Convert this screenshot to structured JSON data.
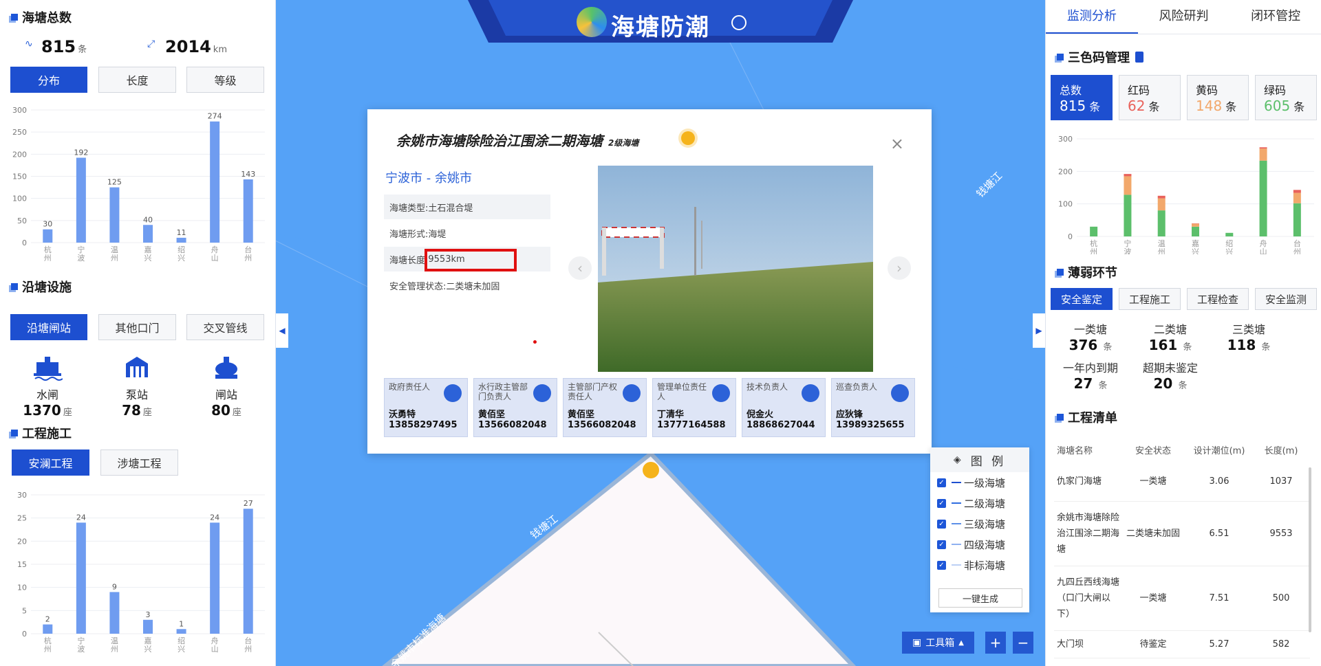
{
  "banner": {
    "title": "海塘防潮"
  },
  "left": {
    "total": {
      "title": "海塘总数",
      "count": "815",
      "count_unit": "条",
      "length": "2014",
      "length_unit": "km"
    },
    "dist_tabs": [
      "分布",
      "长度",
      "等级"
    ],
    "facilities_title": "沿塘设施",
    "facility_tabs": [
      "沿塘闸站",
      "其他口门",
      "交叉管线"
    ],
    "facilities": [
      {
        "label": "水闸",
        "value": "1370",
        "unit": "座",
        "icon": "sluice-icon"
      },
      {
        "label": "泵站",
        "value": "78",
        "unit": "座",
        "icon": "pump-station-icon"
      },
      {
        "label": "闸站",
        "value": "80",
        "unit": "座",
        "icon": "gate-station-icon"
      }
    ],
    "construction_title": "工程施工",
    "construction_tabs": [
      "安澜工程",
      "涉塘工程"
    ]
  },
  "chart_data": [
    {
      "type": "bar",
      "categories": [
        "杭州",
        "宁波",
        "温州",
        "嘉兴",
        "绍兴",
        "舟山",
        "台州"
      ],
      "values": [
        30,
        192,
        125,
        40,
        11,
        274,
        143
      ],
      "yticks": [
        0,
        50,
        100,
        150,
        200,
        250,
        300
      ],
      "ylim": [
        0,
        300
      ]
    },
    {
      "type": "bar",
      "categories": [
        "杭州",
        "宁波",
        "温州",
        "嘉兴",
        "绍兴",
        "舟山",
        "台州"
      ],
      "values": [
        2,
        24,
        9,
        3,
        1,
        24,
        27
      ],
      "yticks": [
        0,
        5,
        10,
        15,
        20,
        25,
        30
      ],
      "ylim": [
        0,
        30
      ]
    },
    {
      "type": "bar",
      "stacked": true,
      "categories": [
        "杭州",
        "宁波",
        "温州",
        "嘉兴",
        "绍兴",
        "舟山",
        "台州"
      ],
      "series": [
        {
          "color": "#5cbf6b",
          "values": [
            30,
            128,
            80,
            30,
            11,
            233,
            102
          ]
        },
        {
          "color": "#f2a86b",
          "values": [
            0,
            57,
            37,
            9,
            0,
            37,
            32
          ]
        },
        {
          "color": "#e9625b",
          "values": [
            0,
            7,
            8,
            1,
            0,
            4,
            9
          ]
        }
      ],
      "yticks": [
        0,
        100,
        200,
        300
      ],
      "ylim": [
        0,
        300
      ]
    }
  ],
  "popup": {
    "title": "余姚市海塘除险治江围涂二期海塘",
    "level": "2级海塘",
    "location": "宁波市 - 余姚市",
    "rows": [
      {
        "label": "海塘类型:",
        "value": "土石混合堤"
      },
      {
        "label": "海塘形式:",
        "value": "海堤"
      },
      {
        "label": "海塘长度:",
        "value": "9553km"
      },
      {
        "label": "安全管理状态:",
        "value": "二类塘未加固"
      }
    ],
    "persons": [
      {
        "role": "政府责任人",
        "name": "沃勇特",
        "phone": "13858297495"
      },
      {
        "role": "水行政主管部门负责人",
        "name": "黄佰坚",
        "phone": "13566082048"
      },
      {
        "role": "主管部门产权责任人",
        "name": "黄佰坚",
        "phone": "13566082048"
      },
      {
        "role": "管理单位责任人",
        "name": "丁清华",
        "phone": "13777164588"
      },
      {
        "role": "技术负责人",
        "name": "倪金火",
        "phone": "18868627044"
      },
      {
        "role": "巡查负责人",
        "name": "应狄锋",
        "phone": "13989325655"
      }
    ]
  },
  "map": {
    "river1": "钱塘江",
    "river2": "钱塘江",
    "seawall": "余姚市标准海塘"
  },
  "legend": {
    "title": "图 例",
    "items": [
      "一级海塘",
      "二级海塘",
      "三级海塘",
      "四级海塘",
      "非标海塘"
    ],
    "generate": "一键生成"
  },
  "toolbar": {
    "tools": "工具箱",
    "plus": "+",
    "minus": "−"
  },
  "right": {
    "tabs": [
      "监测分析",
      "风险研判",
      "闭环管控"
    ],
    "code_title": "三色码管理",
    "codes": [
      {
        "label": "总数",
        "value": "815",
        "unit": "条",
        "color": "#ffffff"
      },
      {
        "label": "红码",
        "value": "62",
        "unit": "条",
        "color": "#e9625b"
      },
      {
        "label": "黄码",
        "value": "148",
        "unit": "条",
        "color": "#f2a86b"
      },
      {
        "label": "绿码",
        "value": "605",
        "unit": "条",
        "color": "#5cbf6b"
      }
    ],
    "weak_title": "薄弱环节",
    "weak_tabs": [
      "安全鉴定",
      "工程施工",
      "工程检查",
      "安全监测"
    ],
    "weak_stats": [
      {
        "label": "一类塘",
        "value": "376",
        "unit": "条"
      },
      {
        "label": "二类塘",
        "value": "161",
        "unit": "条"
      },
      {
        "label": "三类塘",
        "value": "118",
        "unit": "条"
      },
      {
        "label": "一年内到期",
        "value": "27",
        "unit": "条"
      },
      {
        "label": "超期未鉴定",
        "value": "20",
        "unit": "条"
      }
    ],
    "project_title": "工程清单",
    "table_head": [
      "海塘名称",
      "安全状态",
      "设计潮位(m)",
      "长度(m)"
    ],
    "table_rows": [
      [
        "仇家门海塘",
        "一类塘",
        "3.06",
        "1037"
      ],
      [
        "余姚市海塘除险治江围涂二期海塘",
        "二类塘未加固",
        "6.51",
        "9553"
      ],
      [
        "九四丘西线海塘（口门大闸以下）",
        "一类塘",
        "7.51",
        "500"
      ],
      [
        "大门坝",
        "待鉴定",
        "5.27",
        "582"
      ]
    ]
  }
}
